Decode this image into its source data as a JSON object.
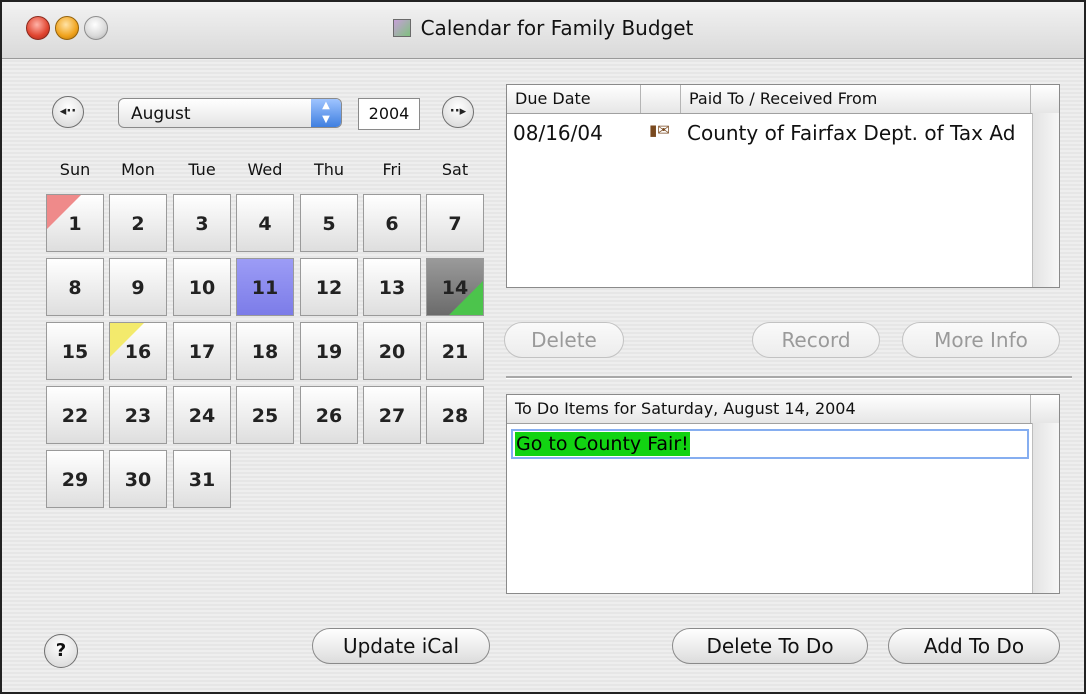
{
  "window": {
    "title": "Calendar for Family Budget",
    "title_icon": "budget-app-icon"
  },
  "nav": {
    "prev_icon": "back-arrow-icon",
    "next_icon": "forward-arrow-icon",
    "month": "August",
    "year": "2004"
  },
  "weekdays": [
    "Sun",
    "Mon",
    "Tue",
    "Wed",
    "Thu",
    "Fri",
    "Sat"
  ],
  "days": [
    {
      "label": "1",
      "marker": "red"
    },
    {
      "label": "2"
    },
    {
      "label": "3"
    },
    {
      "label": "4"
    },
    {
      "label": "5"
    },
    {
      "label": "6"
    },
    {
      "label": "7"
    },
    {
      "label": "8"
    },
    {
      "label": "9"
    },
    {
      "label": "10"
    },
    {
      "label": "11",
      "state": "today"
    },
    {
      "label": "12"
    },
    {
      "label": "13"
    },
    {
      "label": "14",
      "state": "selected",
      "marker": "green"
    },
    {
      "label": "15"
    },
    {
      "label": "16",
      "marker": "yellow"
    },
    {
      "label": "17"
    },
    {
      "label": "18"
    },
    {
      "label": "19"
    },
    {
      "label": "20"
    },
    {
      "label": "21"
    },
    {
      "label": "22"
    },
    {
      "label": "23"
    },
    {
      "label": "24"
    },
    {
      "label": "25"
    },
    {
      "label": "26"
    },
    {
      "label": "27"
    },
    {
      "label": "28"
    },
    {
      "label": "29"
    },
    {
      "label": "30"
    },
    {
      "label": "31"
    }
  ],
  "marker_colors": {
    "red": "#ef8a8a",
    "green": "#4cc44c",
    "yellow": "#f3ea6c",
    "today": "#8c8cf0",
    "selected": "#7a7a7a"
  },
  "bills": {
    "headers": [
      "Due Date",
      "",
      "Paid To / Received From"
    ],
    "rows": [
      {
        "due": "08/16/04",
        "icon": "payment-icon",
        "payee": "County of Fairfax Dept. of Tax Ad"
      }
    ]
  },
  "bill_buttons": {
    "delete": "Delete",
    "record": "Record",
    "more_info": "More Info"
  },
  "todo": {
    "header": "To Do Items for Saturday, August 14, 2004",
    "items": [
      "Go to County Fair!"
    ],
    "highlight": "#12d312"
  },
  "bottom_buttons": {
    "help": "?",
    "update_ical": "Update iCal",
    "delete_todo": "Delete To Do",
    "add_todo": "Add To Do"
  }
}
